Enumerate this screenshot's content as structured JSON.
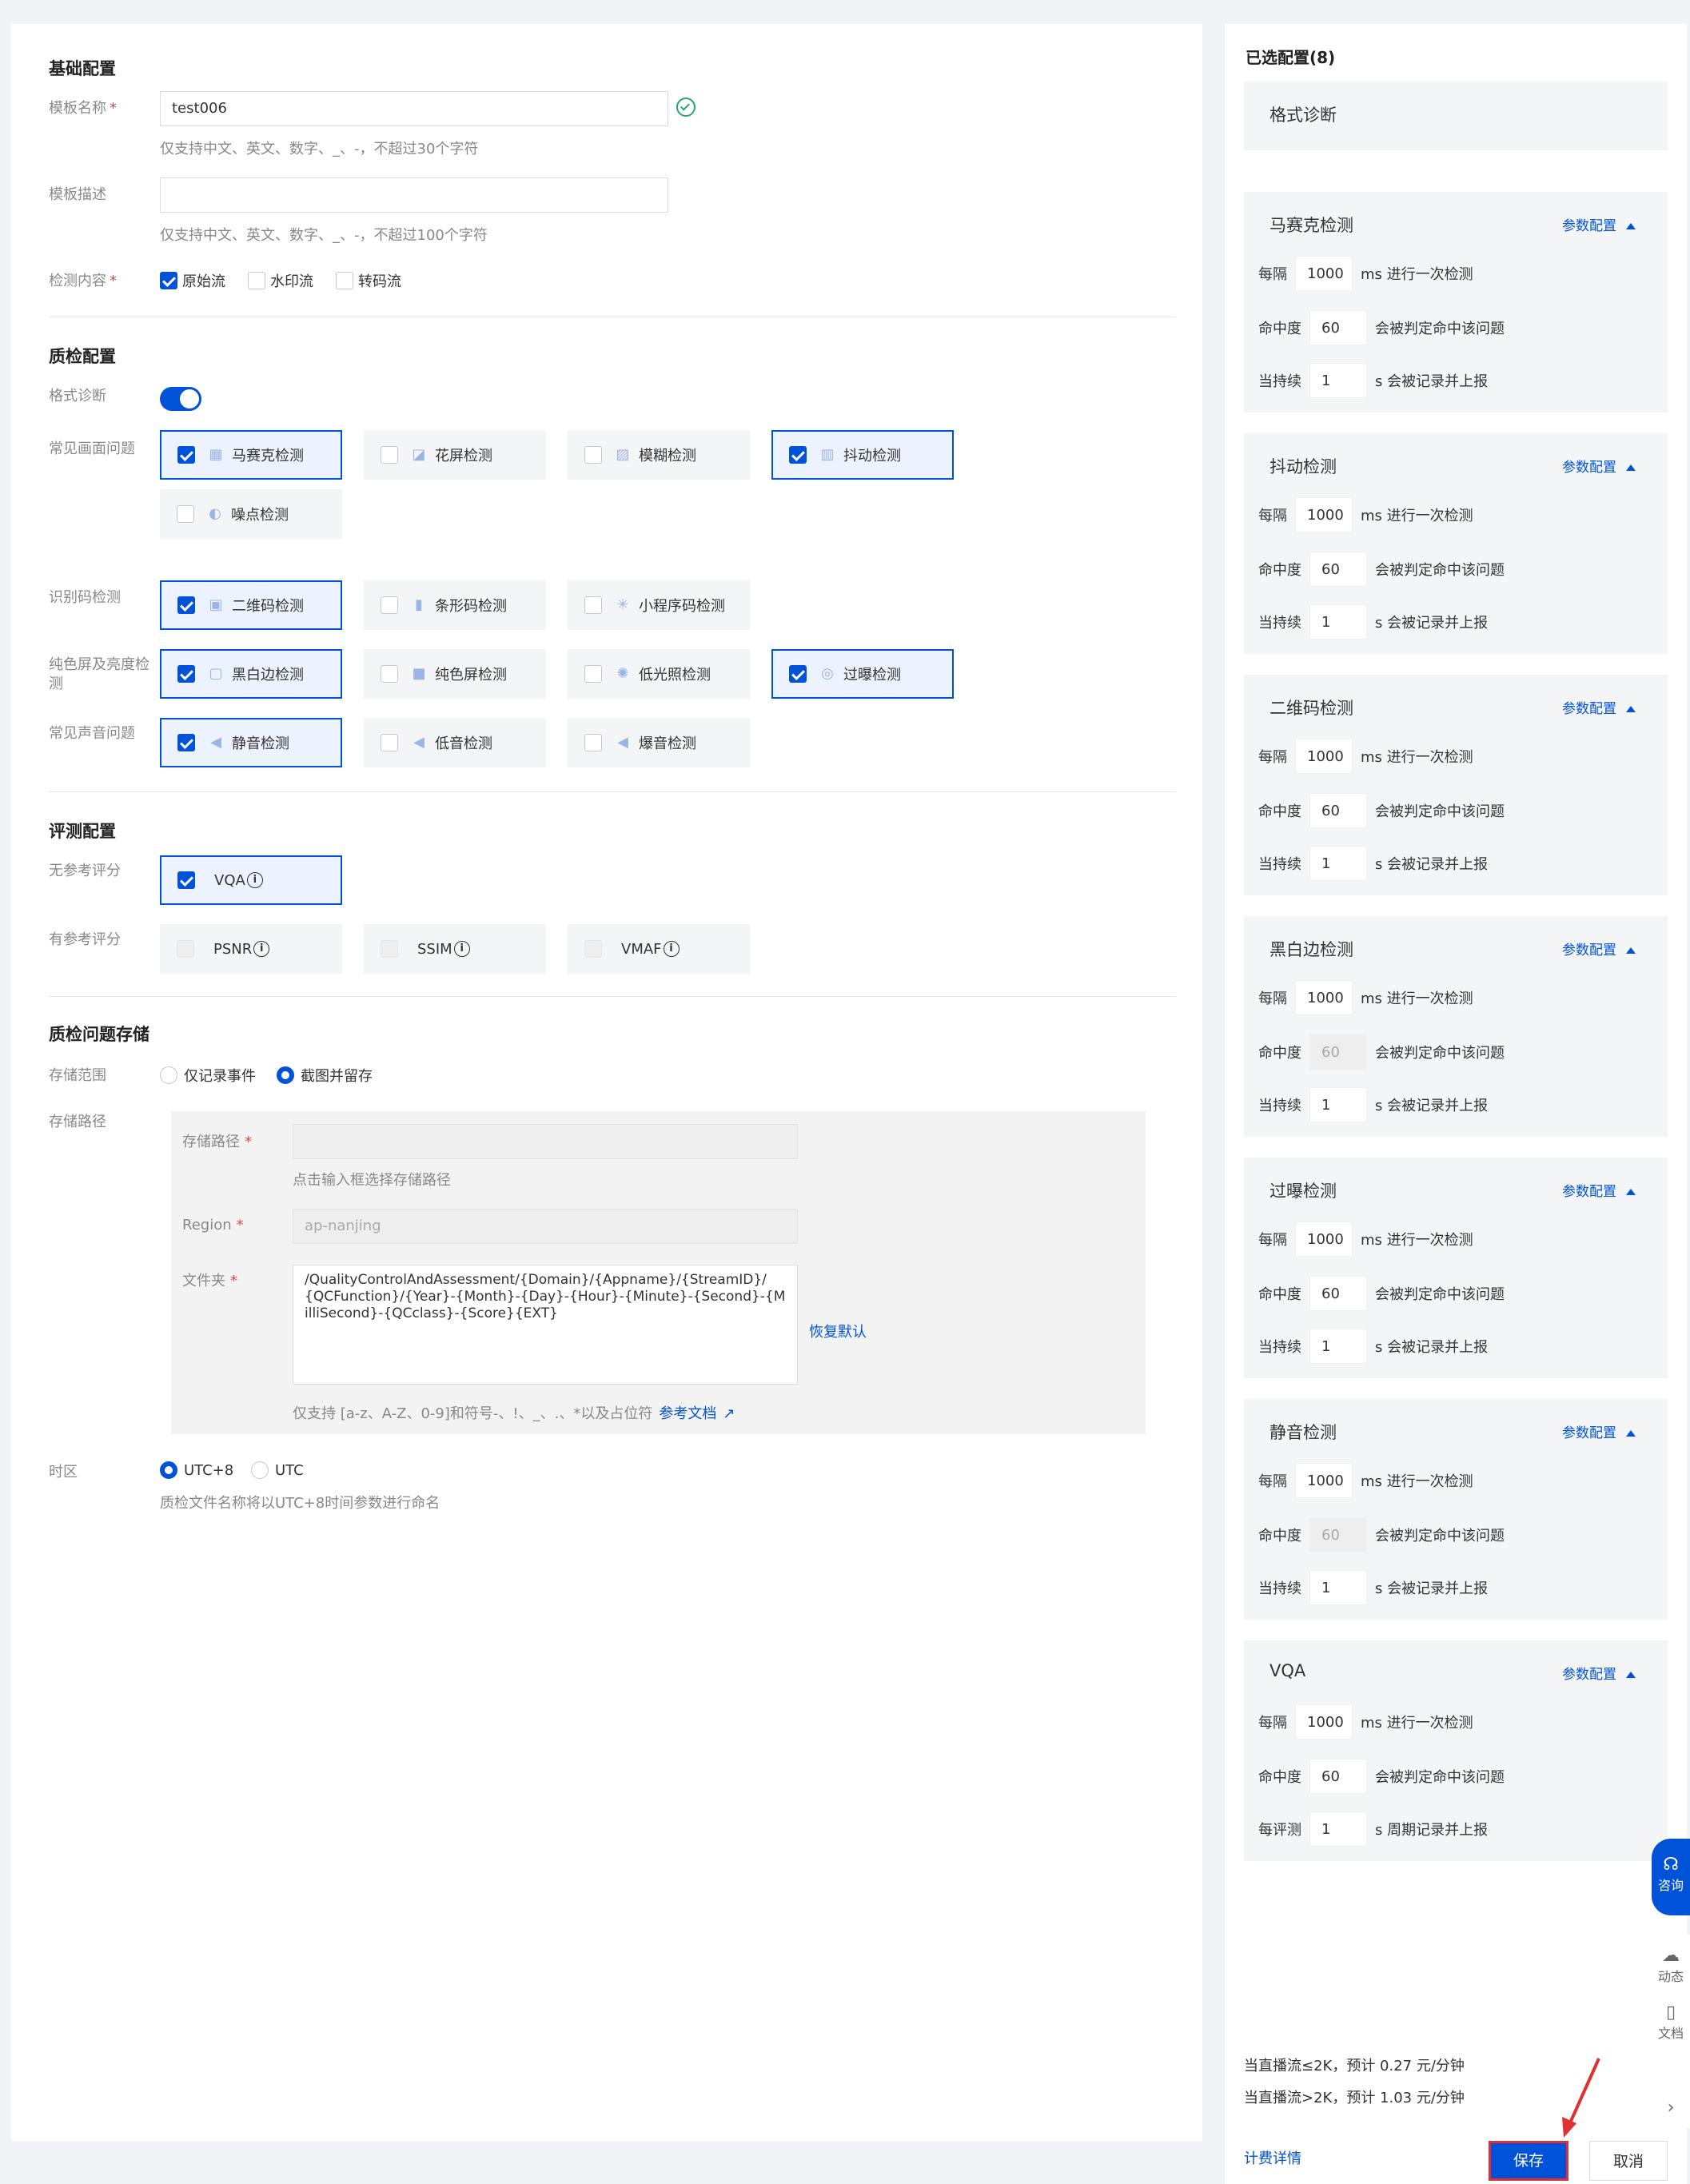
{
  "basic": {
    "title": "基础配置",
    "name_label": "模板名称",
    "name_value": "test006",
    "name_hint": "仅支持中文、英文、数字、_、-，不超过30个字符",
    "desc_label": "模板描述",
    "desc_value": "",
    "desc_hint": "仅支持中文、英文、数字、_、-，不超过100个字符",
    "content_label": "检测内容",
    "content_options": [
      {
        "label": "原始流",
        "checked": true
      },
      {
        "label": "水印流",
        "checked": false
      },
      {
        "label": "转码流",
        "checked": false
      }
    ]
  },
  "qc": {
    "title": "质检配置",
    "format_label": "格式诊断",
    "screen_label": "常见画面问题",
    "code_label": "识别码检测",
    "bright_label": "纯色屏及亮度检测",
    "sound_label": "常见声音问题",
    "screen": [
      {
        "label": "马赛克检测",
        "checked": true,
        "icon": "mosaic-icon"
      },
      {
        "label": "花屏检测",
        "checked": false,
        "icon": "glitch-icon"
      },
      {
        "label": "模糊检测",
        "checked": false,
        "icon": "blur-icon"
      },
      {
        "label": "抖动检测",
        "checked": true,
        "icon": "jitter-icon"
      },
      {
        "label": "噪点检测",
        "checked": false,
        "icon": "noise-icon"
      }
    ],
    "code": [
      {
        "label": "二维码检测",
        "checked": true,
        "icon": "qrcode-icon"
      },
      {
        "label": "条形码检测",
        "checked": false,
        "icon": "barcode-icon"
      },
      {
        "label": "小程序码检测",
        "checked": false,
        "icon": "miniprogram-icon"
      }
    ],
    "bright": [
      {
        "label": "黑白边检测",
        "checked": true,
        "icon": "border-icon"
      },
      {
        "label": "纯色屏检测",
        "checked": false,
        "icon": "solid-screen-icon"
      },
      {
        "label": "低光照检测",
        "checked": false,
        "icon": "low-light-icon"
      },
      {
        "label": "过曝检测",
        "checked": true,
        "icon": "overexposure-icon"
      }
    ],
    "sound": [
      {
        "label": "静音检测",
        "checked": true,
        "icon": "mute-icon"
      },
      {
        "label": "低音检测",
        "checked": false,
        "icon": "low-volume-icon"
      },
      {
        "label": "爆音检测",
        "checked": false,
        "icon": "loud-icon"
      }
    ]
  },
  "eval": {
    "title": "评测配置",
    "noref_label": "无参考评分",
    "ref_label": "有参考评分",
    "noref": [
      {
        "label": "VQA",
        "checked": true
      }
    ],
    "ref": [
      {
        "label": "PSNR",
        "checked": false
      },
      {
        "label": "SSIM",
        "checked": false
      },
      {
        "label": "VMAF",
        "checked": false
      }
    ]
  },
  "storage": {
    "title": "质检问题存储",
    "range_label": "存储范围",
    "range_opt1": "仅记录事件",
    "range_opt2": "截图并留存",
    "path_label": "存储路径",
    "inner_path_label": "存储路径",
    "inner_path_value": "",
    "inner_path_hint": "点击输入框选择存储路径",
    "region_label": "Region",
    "region_value": "ap-nanjing",
    "folder_label": "文件夹",
    "folder_value": "/QualityControlAndAssessment/{Domain}/{Appname}/{StreamID}/{QCFunction}/{Year}-{Month}-{Day}-{Hour}-{Minute}-{Second}-{MilliSecond}-{QCclass}-{Score}{EXT}",
    "restore": "恢复默认",
    "folder_hint": "仅支持 [a-z、A-Z、0-9]和符号-、!、_、.、*以及占位符",
    "doc_link": "参考文档"
  },
  "timezone": {
    "label": "时区",
    "opt1": "UTC+8",
    "opt2": "UTC",
    "hint": "质检文件名称将以UTC+8时间参数进行命名"
  },
  "selected": {
    "title": "已选配置(8)",
    "format_item": "格式诊断",
    "param_label": "参数配置",
    "items": [
      {
        "name": "马赛克检测",
        "interval": "1000",
        "hit": "60",
        "hit_disabled": false,
        "last": "1",
        "last_prefix": "当持续",
        "last_suffix": "s 会被记录并上报"
      },
      {
        "name": "抖动检测",
        "interval": "1000",
        "hit": "60",
        "hit_disabled": false,
        "last": "1",
        "last_prefix": "当持续",
        "last_suffix": "s 会被记录并上报"
      },
      {
        "name": "二维码检测",
        "interval": "1000",
        "hit": "60",
        "hit_disabled": false,
        "last": "1",
        "last_prefix": "当持续",
        "last_suffix": "s 会被记录并上报"
      },
      {
        "name": "黑白边检测",
        "interval": "1000",
        "hit": "60",
        "hit_disabled": true,
        "last": "1",
        "last_prefix": "当持续",
        "last_suffix": "s 会被记录并上报"
      },
      {
        "name": "过曝检测",
        "interval": "1000",
        "hit": "60",
        "hit_disabled": false,
        "last": "1",
        "last_prefix": "当持续",
        "last_suffix": "s 会被记录并上报"
      },
      {
        "name": "静音检测",
        "interval": "1000",
        "hit": "60",
        "hit_disabled": true,
        "last": "1",
        "last_prefix": "当持续",
        "last_suffix": "s 会被记录并上报"
      },
      {
        "name": "VQA",
        "interval": "1000",
        "hit": "60",
        "hit_disabled": false,
        "last": "1",
        "last_prefix": "每评测",
        "last_suffix": "s 周期记录并上报"
      }
    ],
    "every": "每隔",
    "ms_text": "ms 进行一次检测",
    "hit_label": "命中度",
    "hit_text": "会被判定命中该问题"
  },
  "pricing": {
    "line1": "当直播流≤2K，预计 0.27 元/分钟",
    "line2": "当直播流>2K，预计 1.03 元/分钟",
    "detail": "计费详情",
    "save": "保存",
    "cancel": "取消"
  },
  "float": {
    "consult": "咨询",
    "dynamic": "动态",
    "docs": "文档"
  },
  "colors": {
    "primary": "#0052d9",
    "danger": "#e54545",
    "success": "#2ba471"
  }
}
